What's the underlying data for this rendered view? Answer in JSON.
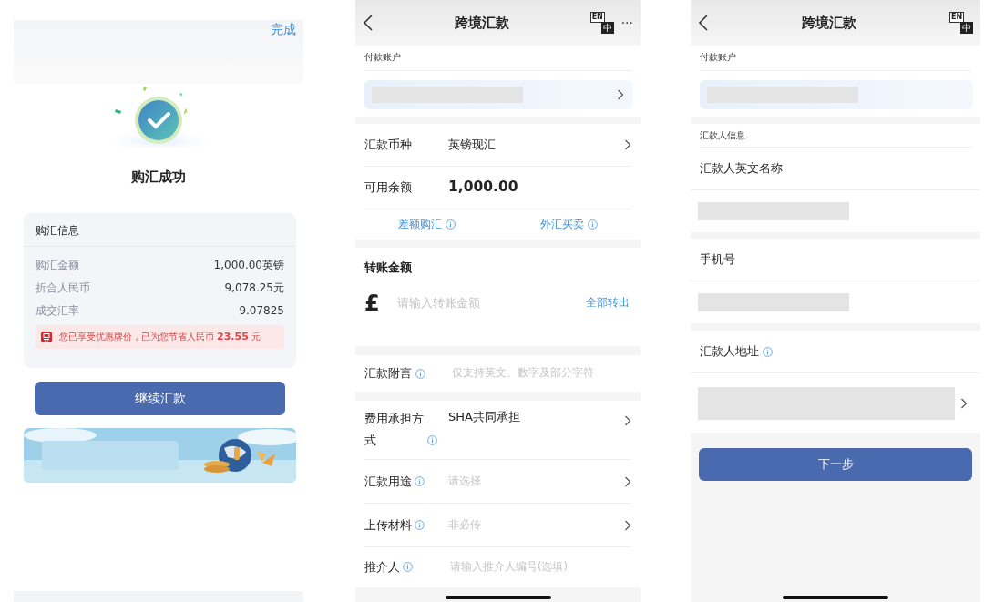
{
  "success_screen": {
    "done_link": "完成",
    "title": "购汇成功",
    "card_title": "购汇信息",
    "rows": [
      {
        "label": "购汇金额",
        "value": "1,000.00英镑"
      },
      {
        "label": "折合人民币",
        "value": "9,078.25元"
      },
      {
        "label": "成交汇率",
        "value": "9.07825"
      }
    ],
    "notice": "您已享受优惠牌价，已为您节省人民币 **23.55** 元",
    "button": "继续汇款"
  },
  "transfer_screen": {
    "title": "跨境汇款",
    "lang_toggle": {
      "top": "EN",
      "bottom": "中"
    },
    "more": "···",
    "account_label": "付款账户",
    "rows": [
      {
        "kind": "select",
        "label": "汇款币种",
        "value": "英镑现汇"
      },
      {
        "kind": "static",
        "label": "可用余额",
        "value": "1,000.00"
      }
    ],
    "links": [
      "差额购汇",
      "外汇买卖"
    ],
    "amount": {
      "label": "转账金额",
      "currency_symbol": "£",
      "placeholder": "请输入转账金额",
      "action": "全部转出"
    },
    "remark": {
      "label": "汇款附言",
      "placeholder": "仅支持英文、数字及部分字符"
    },
    "details": [
      {
        "kind": "select",
        "label": "费用承担方式",
        "value": "SHA共同承担"
      },
      {
        "kind": "select",
        "label": "汇款用途",
        "placeholder": "请选择"
      },
      {
        "kind": "select",
        "label": "上传材料",
        "placeholder": "非必传"
      },
      {
        "kind": "input",
        "label": "推介人",
        "placeholder": "请输入推介人编号(选填)"
      }
    ]
  },
  "payer_screen": {
    "title": "跨境汇款",
    "lang_toggle": {
      "top": "EN",
      "bottom": "中"
    },
    "account_label": "付款账户",
    "section_label": "汇款人信息",
    "fields": [
      {
        "label": "汇款人英文名称",
        "info": false,
        "chevron": false
      },
      {
        "label": "手机号",
        "info": false,
        "chevron": false
      },
      {
        "label": "汇款人地址",
        "info": true,
        "chevron": true
      }
    ],
    "button": "下一步"
  }
}
